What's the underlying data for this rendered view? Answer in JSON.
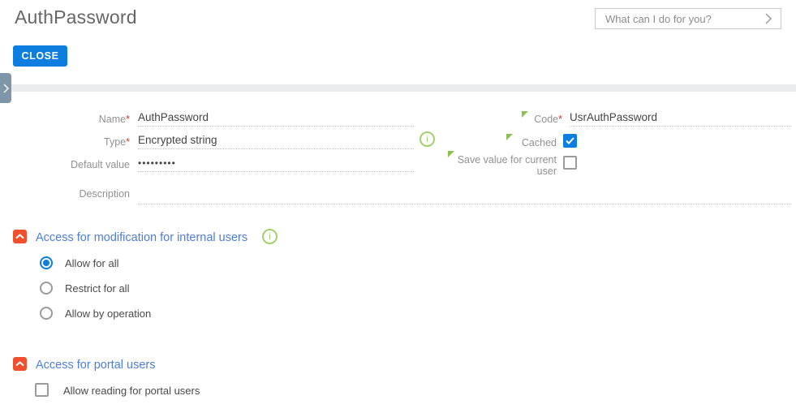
{
  "header": {
    "title": "AuthPassword",
    "assistant": {
      "placeholder": "What can I do for you?"
    }
  },
  "toolbar": {
    "close_label": "CLOSE"
  },
  "icons": {
    "info_glyph": "i"
  },
  "colors": {
    "primary_blue": "#0d7ee0",
    "section_orange": "#f0502d",
    "section_title_blue": "#4d7edb",
    "changed_marker_green": "#8CC152",
    "info_green": "#a5cf6d",
    "side_tab_slate": "#7f95a8"
  },
  "form": {
    "left": [
      {
        "label": "Name",
        "req": "*",
        "value": "AuthPassword"
      },
      {
        "label": "Type",
        "req": "*",
        "value": "Encrypted string",
        "info": true
      },
      {
        "label": "Default value",
        "value": "•••••••••"
      },
      {
        "label": "Description",
        "value": ""
      }
    ],
    "right": [
      {
        "label": "Code",
        "req": "*",
        "value": "UsrAuthPassword",
        "changed": true
      },
      {
        "label": "Cached",
        "type": "checkbox",
        "checked": true,
        "changed": true
      },
      {
        "label": "Save value for current user",
        "type": "checkbox",
        "checked": false,
        "changed": true
      }
    ]
  },
  "sections": [
    {
      "title": "Access for modification for internal users",
      "info": true,
      "control": "radio",
      "options": [
        {
          "label": "Allow for all",
          "selected": true
        },
        {
          "label": "Restrict for all",
          "selected": false
        },
        {
          "label": "Allow by operation",
          "selected": false
        }
      ]
    },
    {
      "title": "Access for portal users",
      "control": "checkbox",
      "options": [
        {
          "label": "Allow reading for portal users",
          "checked": false
        }
      ]
    }
  ]
}
